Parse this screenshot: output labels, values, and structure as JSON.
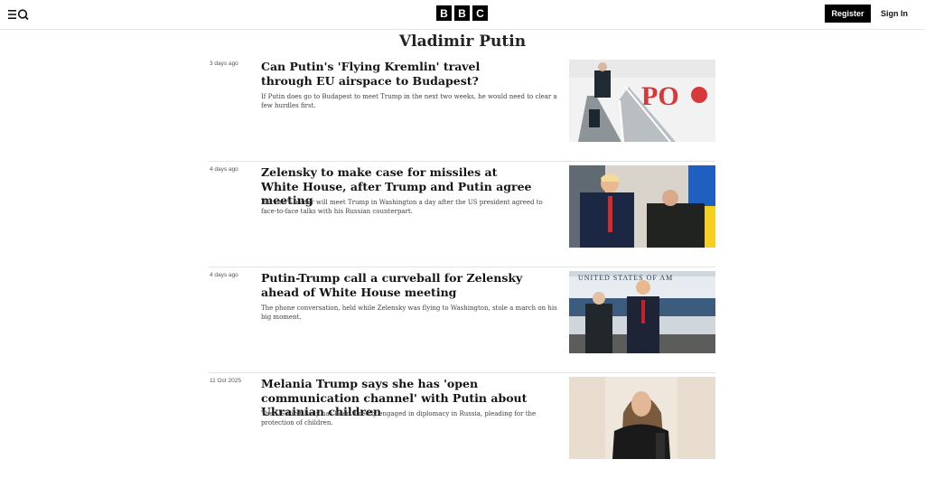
{
  "header": {
    "logo_letters": [
      "B",
      "B",
      "C"
    ],
    "register_label": "Register",
    "signin_label": "Sign In",
    "menu_icon": "menu-icon",
    "search_icon": "search-icon"
  },
  "page": {
    "title": "Vladimir Putin"
  },
  "articles": [
    {
      "date": "3 days ago",
      "headline": "Can Putin's 'Flying Kremlin' travel through EU airspace to Budapest?",
      "summary": "If Putin does go to Budapest to meet Trump in the next two weeks, he would need to clear a few hurdles first."
    },
    {
      "date": "4 days ago",
      "headline": "Zelensky to make case for missiles at White House, after Trump and Putin agree meeting",
      "summary": "Ukraine's leader will meet Trump in Washington a day after the US president agreed to face-to-face talks with his Russian counterpart."
    },
    {
      "date": "4 days ago",
      "headline": "Putin-Trump call a curveball for Zelensky ahead of White House meeting",
      "summary": "The phone conversation, held while Zelensky was flying to Washington, stole a march on his big moment."
    },
    {
      "date": "11 Oct 2025",
      "headline": "Melania Trump says she has 'open communication channel' with Putin about Ukrainian children",
      "summary": "The US First Lady has been directly engaged in diplomacy in Russia, pleading for the protection of children."
    }
  ],
  "images": {
    "plane_lettering": "PO",
    "plane2_lettering": "UNITED STATES OF AM"
  }
}
